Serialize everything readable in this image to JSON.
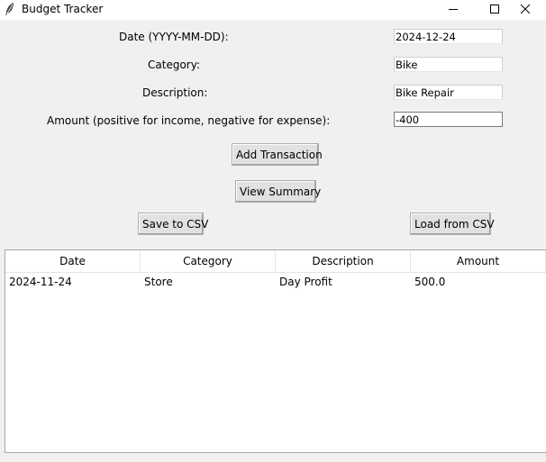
{
  "window": {
    "title": "Budget Tracker",
    "icon": "feather-icon",
    "minimize_icon": "minimize-icon",
    "maximize_icon": "maximize-icon",
    "close_icon": "close-icon"
  },
  "form": {
    "date_label": "Date (YYYY-MM-DD):",
    "date_value": "2024-12-24",
    "category_label": "Category:",
    "category_value": "Bike",
    "description_label": "Description:",
    "description_value": "Bike Repair",
    "amount_label": "Amount (positive for income, negative for expense):",
    "amount_value": "-400"
  },
  "buttons": {
    "add": "Add Transaction",
    "summary": "View Summary",
    "save": "Save to CSV",
    "load": "Load from CSV"
  },
  "table": {
    "columns": [
      "Date",
      "Category",
      "Description",
      "Amount"
    ],
    "rows": [
      [
        "2024-11-24",
        "Store",
        "Day Profit",
        "500.0"
      ]
    ]
  }
}
